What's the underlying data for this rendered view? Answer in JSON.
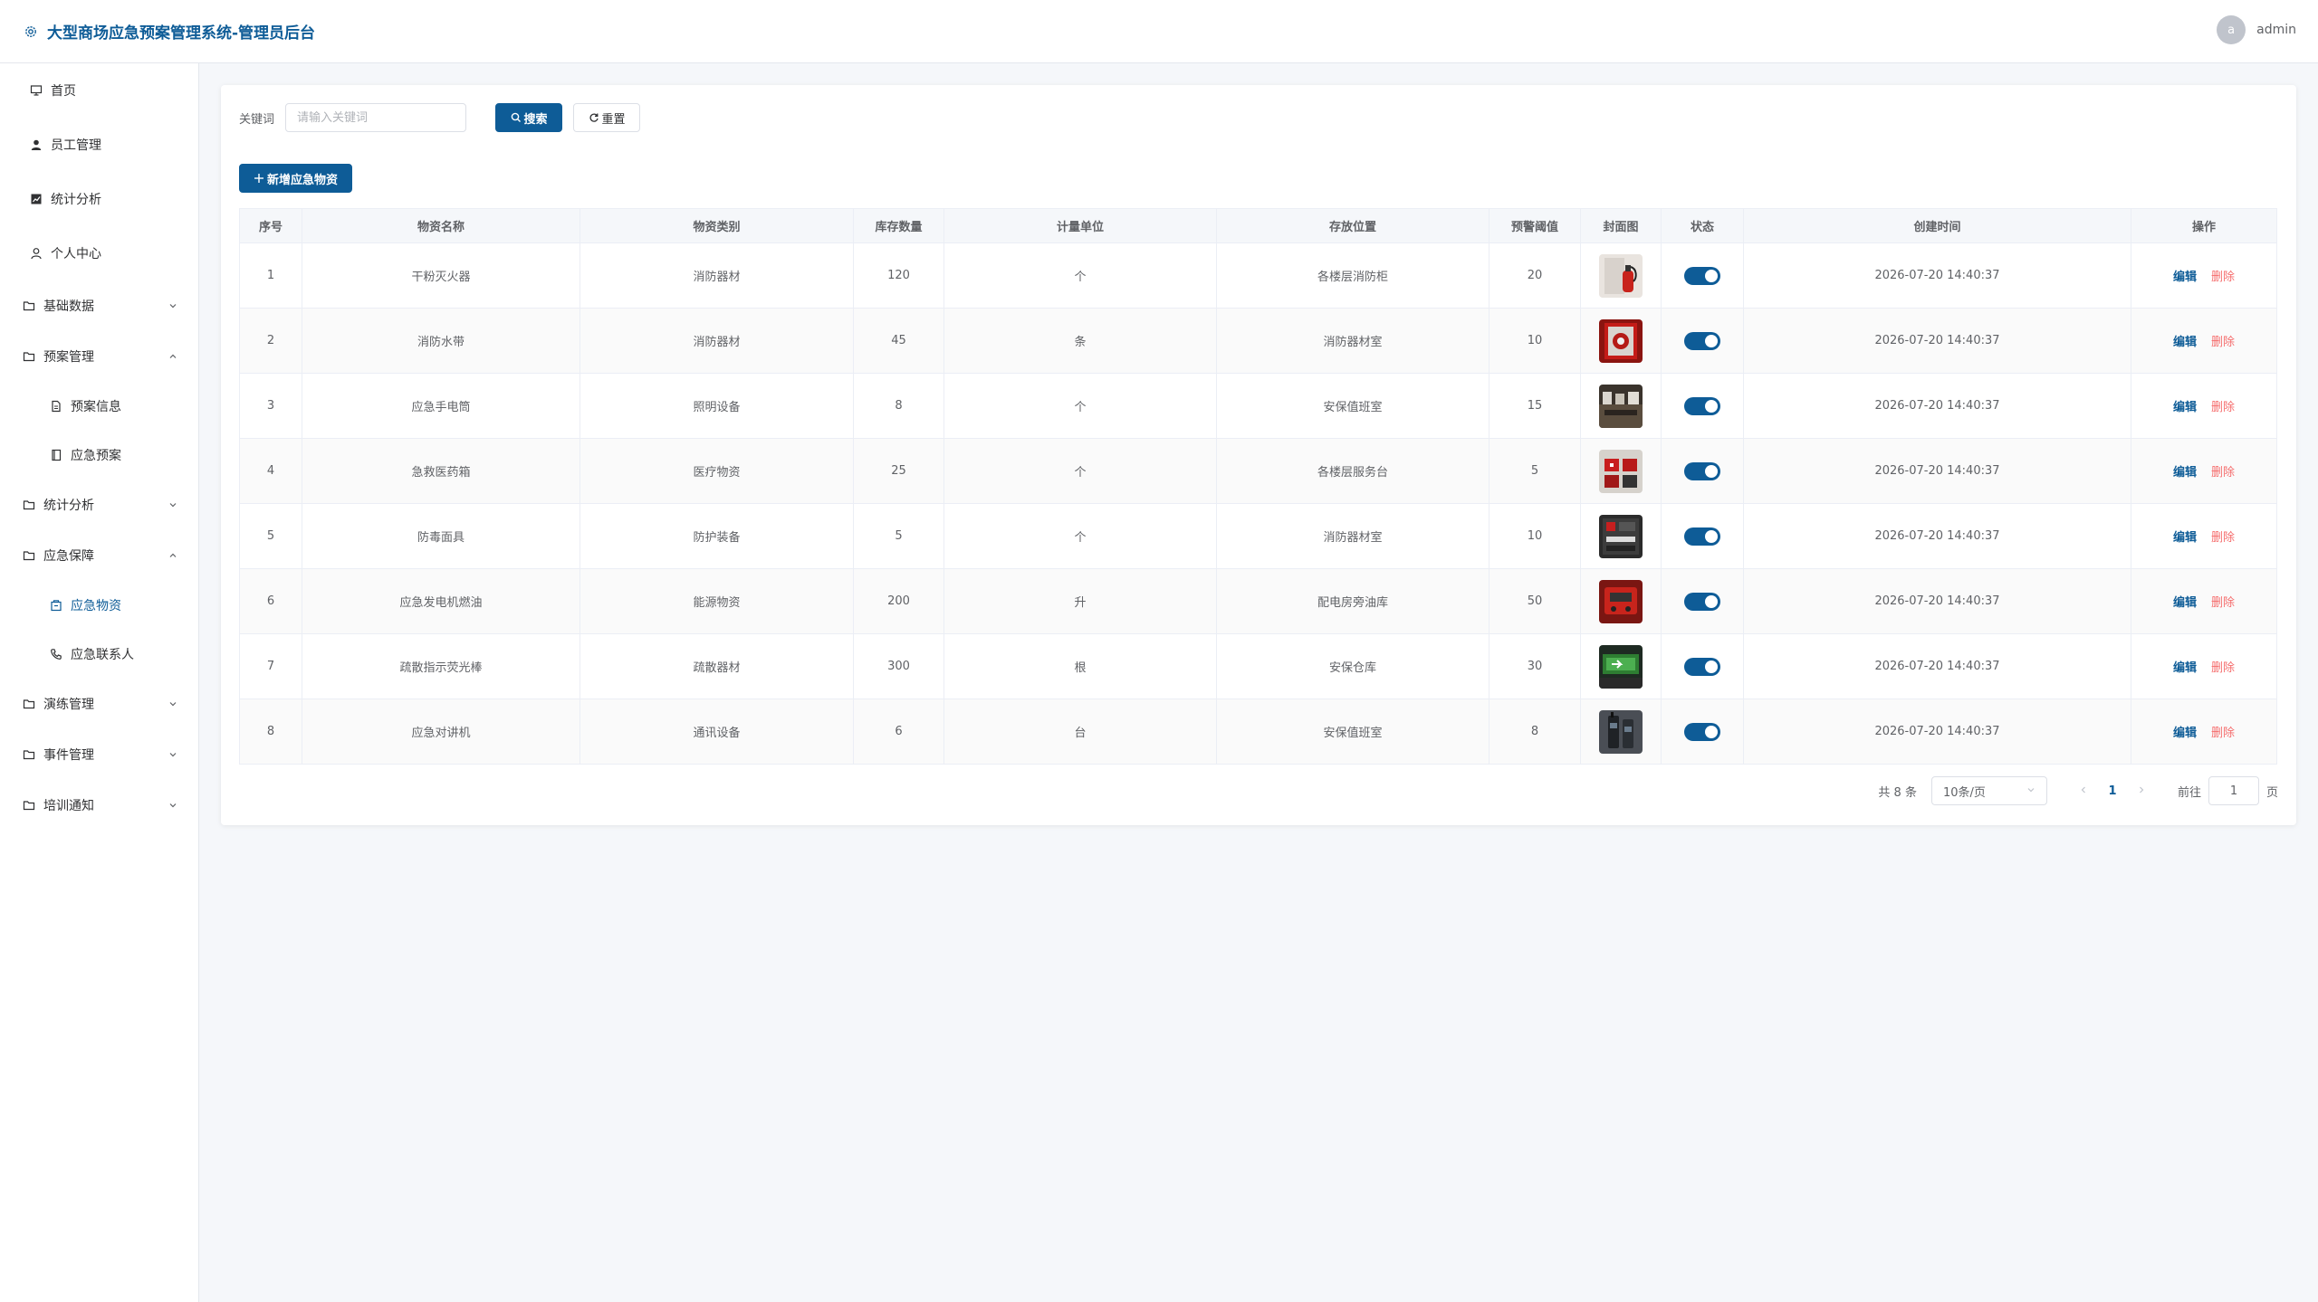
{
  "header": {
    "title": "大型商场应急预案管理系统-管理员后台",
    "avatar_letter": "a",
    "username": "admin"
  },
  "sidebar": {
    "items": [
      {
        "label": "首页",
        "icon": "monitor-icon"
      },
      {
        "label": "员工管理",
        "icon": "user-filled-icon"
      },
      {
        "label": "统计分析",
        "icon": "chart-icon"
      },
      {
        "label": "个人中心",
        "icon": "user-icon"
      },
      {
        "label": "基础数据",
        "icon": "folder-icon",
        "expanded": false
      },
      {
        "label": "预案管理",
        "icon": "folder-icon",
        "expanded": true
      },
      {
        "label": "预案信息",
        "icon": "document-icon"
      },
      {
        "label": "应急预案",
        "icon": "notebook-icon"
      },
      {
        "label": "统计分析",
        "icon": "folder-icon",
        "expanded": false
      },
      {
        "label": "应急保障",
        "icon": "folder-icon",
        "expanded": true
      },
      {
        "label": "应急物资",
        "icon": "box-icon",
        "active": true
      },
      {
        "label": "应急联系人",
        "icon": "phone-icon"
      },
      {
        "label": "演练管理",
        "icon": "folder-icon",
        "expanded": false
      },
      {
        "label": "事件管理",
        "icon": "folder-icon",
        "expanded": false
      },
      {
        "label": "培训通知",
        "icon": "folder-icon",
        "expanded": false
      }
    ]
  },
  "search": {
    "label": "关键词",
    "placeholder": "请输入关键词",
    "search_btn": "搜索",
    "reset_btn": "重置"
  },
  "add_btn": "新增应急物资",
  "table": {
    "headers": [
      "序号",
      "物资名称",
      "物资类别",
      "库存数量",
      "计量单位",
      "存放位置",
      "预警阈值",
      "封面图",
      "状态",
      "创建时间",
      "操作"
    ],
    "rows": [
      {
        "no": "1",
        "name": "干粉灭火器",
        "category": "消防器材",
        "qty": "120",
        "unit": "个",
        "location": "各楼层消防柜",
        "threshold": "20",
        "status": true,
        "created": "2026-07-20 14:40:37"
      },
      {
        "no": "2",
        "name": "消防水带",
        "category": "消防器材",
        "qty": "45",
        "unit": "条",
        "location": "消防器材室",
        "threshold": "10",
        "status": true,
        "created": "2026-07-20 14:40:37"
      },
      {
        "no": "3",
        "name": "应急手电筒",
        "category": "照明设备",
        "qty": "8",
        "unit": "个",
        "location": "安保值班室",
        "threshold": "15",
        "status": true,
        "created": "2026-07-20 14:40:37"
      },
      {
        "no": "4",
        "name": "急救医药箱",
        "category": "医疗物资",
        "qty": "25",
        "unit": "个",
        "location": "各楼层服务台",
        "threshold": "5",
        "status": true,
        "created": "2026-07-20 14:40:37"
      },
      {
        "no": "5",
        "name": "防毒面具",
        "category": "防护装备",
        "qty": "5",
        "unit": "个",
        "location": "消防器材室",
        "threshold": "10",
        "status": true,
        "created": "2026-07-20 14:40:37"
      },
      {
        "no": "6",
        "name": "应急发电机燃油",
        "category": "能源物资",
        "qty": "200",
        "unit": "升",
        "location": "配电房旁油库",
        "threshold": "50",
        "status": true,
        "created": "2026-07-20 14:40:37"
      },
      {
        "no": "7",
        "name": "疏散指示荧光棒",
        "category": "疏散器材",
        "qty": "300",
        "unit": "根",
        "location": "安保仓库",
        "threshold": "30",
        "status": true,
        "created": "2026-07-20 14:40:37"
      },
      {
        "no": "8",
        "name": "应急对讲机",
        "category": "通讯设备",
        "qty": "6",
        "unit": "台",
        "location": "安保值班室",
        "threshold": "8",
        "status": true,
        "created": "2026-07-20 14:40:37"
      }
    ],
    "edit_label": "编辑",
    "delete_label": "删除"
  },
  "pagination": {
    "total": "共 8 条",
    "page_size": "10条/页",
    "current": "1",
    "goto_label": "前往",
    "goto_value": "1",
    "goto_suffix": "页"
  },
  "colors": {
    "primary": "#0e5c97",
    "danger": "#f56c6c"
  }
}
